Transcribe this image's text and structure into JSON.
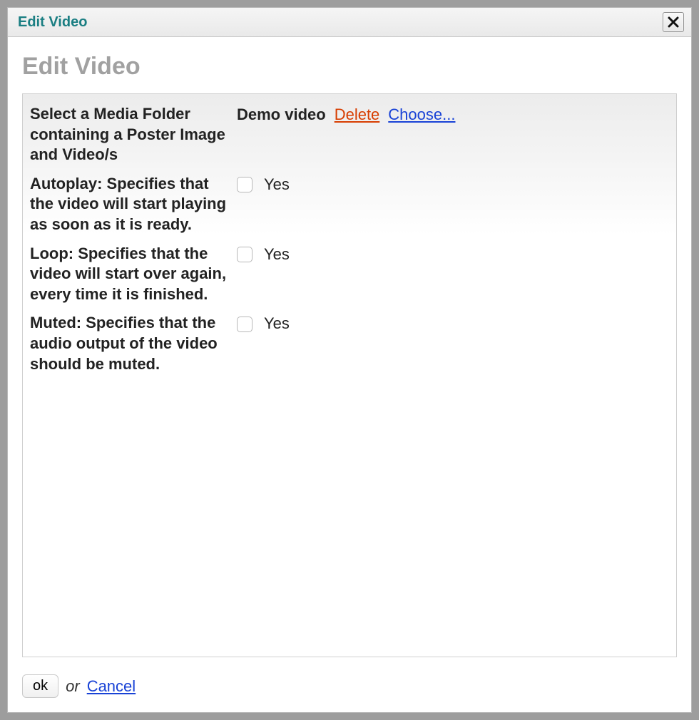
{
  "titlebar": {
    "title": "Edit Video"
  },
  "page": {
    "heading": "Edit Video"
  },
  "fields": {
    "media": {
      "label": "Select a Media Folder containing a Poster Image and Video/s",
      "value": "Demo video",
      "delete": "Delete",
      "choose": "Choose..."
    },
    "autoplay": {
      "label": "Autoplay: Specifies that the video will start playing as soon as it is ready.",
      "option": "Yes"
    },
    "loop": {
      "label": "Loop: Specifies that the video will start over again, every time it is finished.",
      "option": "Yes"
    },
    "muted": {
      "label": "Muted: Specifies that the audio output of the video should be muted.",
      "option": "Yes"
    }
  },
  "actions": {
    "ok": "ok",
    "or": "or",
    "cancel": "Cancel"
  }
}
